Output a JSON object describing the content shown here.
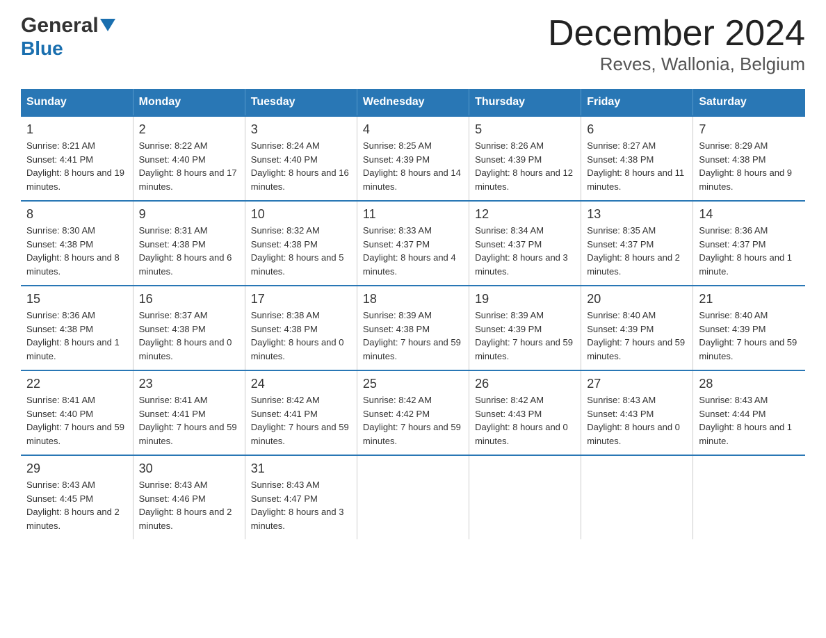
{
  "logo": {
    "general": "General",
    "blue": "Blue",
    "arrow": "▼"
  },
  "title": "December 2024",
  "subtitle": "Reves, Wallonia, Belgium",
  "days_of_week": [
    "Sunday",
    "Monday",
    "Tuesday",
    "Wednesday",
    "Thursday",
    "Friday",
    "Saturday"
  ],
  "weeks": [
    [
      {
        "day": "1",
        "sunrise": "8:21 AM",
        "sunset": "4:41 PM",
        "daylight": "8 hours and 19 minutes."
      },
      {
        "day": "2",
        "sunrise": "8:22 AM",
        "sunset": "4:40 PM",
        "daylight": "8 hours and 17 minutes."
      },
      {
        "day": "3",
        "sunrise": "8:24 AM",
        "sunset": "4:40 PM",
        "daylight": "8 hours and 16 minutes."
      },
      {
        "day": "4",
        "sunrise": "8:25 AM",
        "sunset": "4:39 PM",
        "daylight": "8 hours and 14 minutes."
      },
      {
        "day": "5",
        "sunrise": "8:26 AM",
        "sunset": "4:39 PM",
        "daylight": "8 hours and 12 minutes."
      },
      {
        "day": "6",
        "sunrise": "8:27 AM",
        "sunset": "4:38 PM",
        "daylight": "8 hours and 11 minutes."
      },
      {
        "day": "7",
        "sunrise": "8:29 AM",
        "sunset": "4:38 PM",
        "daylight": "8 hours and 9 minutes."
      }
    ],
    [
      {
        "day": "8",
        "sunrise": "8:30 AM",
        "sunset": "4:38 PM",
        "daylight": "8 hours and 8 minutes."
      },
      {
        "day": "9",
        "sunrise": "8:31 AM",
        "sunset": "4:38 PM",
        "daylight": "8 hours and 6 minutes."
      },
      {
        "day": "10",
        "sunrise": "8:32 AM",
        "sunset": "4:38 PM",
        "daylight": "8 hours and 5 minutes."
      },
      {
        "day": "11",
        "sunrise": "8:33 AM",
        "sunset": "4:37 PM",
        "daylight": "8 hours and 4 minutes."
      },
      {
        "day": "12",
        "sunrise": "8:34 AM",
        "sunset": "4:37 PM",
        "daylight": "8 hours and 3 minutes."
      },
      {
        "day": "13",
        "sunrise": "8:35 AM",
        "sunset": "4:37 PM",
        "daylight": "8 hours and 2 minutes."
      },
      {
        "day": "14",
        "sunrise": "8:36 AM",
        "sunset": "4:37 PM",
        "daylight": "8 hours and 1 minute."
      }
    ],
    [
      {
        "day": "15",
        "sunrise": "8:36 AM",
        "sunset": "4:38 PM",
        "daylight": "8 hours and 1 minute."
      },
      {
        "day": "16",
        "sunrise": "8:37 AM",
        "sunset": "4:38 PM",
        "daylight": "8 hours and 0 minutes."
      },
      {
        "day": "17",
        "sunrise": "8:38 AM",
        "sunset": "4:38 PM",
        "daylight": "8 hours and 0 minutes."
      },
      {
        "day": "18",
        "sunrise": "8:39 AM",
        "sunset": "4:38 PM",
        "daylight": "7 hours and 59 minutes."
      },
      {
        "day": "19",
        "sunrise": "8:39 AM",
        "sunset": "4:39 PM",
        "daylight": "7 hours and 59 minutes."
      },
      {
        "day": "20",
        "sunrise": "8:40 AM",
        "sunset": "4:39 PM",
        "daylight": "7 hours and 59 minutes."
      },
      {
        "day": "21",
        "sunrise": "8:40 AM",
        "sunset": "4:39 PM",
        "daylight": "7 hours and 59 minutes."
      }
    ],
    [
      {
        "day": "22",
        "sunrise": "8:41 AM",
        "sunset": "4:40 PM",
        "daylight": "7 hours and 59 minutes."
      },
      {
        "day": "23",
        "sunrise": "8:41 AM",
        "sunset": "4:41 PM",
        "daylight": "7 hours and 59 minutes."
      },
      {
        "day": "24",
        "sunrise": "8:42 AM",
        "sunset": "4:41 PM",
        "daylight": "7 hours and 59 minutes."
      },
      {
        "day": "25",
        "sunrise": "8:42 AM",
        "sunset": "4:42 PM",
        "daylight": "7 hours and 59 minutes."
      },
      {
        "day": "26",
        "sunrise": "8:42 AM",
        "sunset": "4:43 PM",
        "daylight": "8 hours and 0 minutes."
      },
      {
        "day": "27",
        "sunrise": "8:43 AM",
        "sunset": "4:43 PM",
        "daylight": "8 hours and 0 minutes."
      },
      {
        "day": "28",
        "sunrise": "8:43 AM",
        "sunset": "4:44 PM",
        "daylight": "8 hours and 1 minute."
      }
    ],
    [
      {
        "day": "29",
        "sunrise": "8:43 AM",
        "sunset": "4:45 PM",
        "daylight": "8 hours and 2 minutes."
      },
      {
        "day": "30",
        "sunrise": "8:43 AM",
        "sunset": "4:46 PM",
        "daylight": "8 hours and 2 minutes."
      },
      {
        "day": "31",
        "sunrise": "8:43 AM",
        "sunset": "4:47 PM",
        "daylight": "8 hours and 3 minutes."
      },
      null,
      null,
      null,
      null
    ]
  ],
  "labels": {
    "sunrise": "Sunrise:",
    "sunset": "Sunset:",
    "daylight": "Daylight:"
  }
}
